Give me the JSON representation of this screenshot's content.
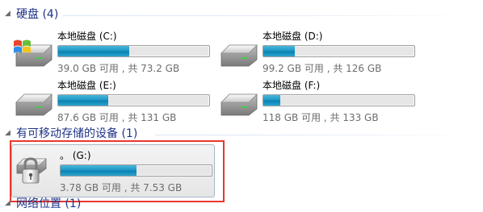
{
  "hard_disks": {
    "header": "硬盘 (4)",
    "drives": [
      {
        "name": "本地磁盘 (C:)",
        "free": "39.0 GB 可用 , 共 73.2 GB",
        "used_fraction": 0.47,
        "icon": "windows-system-drive-icon"
      },
      {
        "name": "本地磁盘 (D:)",
        "free": "99.2 GB 可用 , 共 126 GB",
        "used_fraction": 0.21,
        "icon": "hard-drive-icon"
      },
      {
        "name": "本地磁盘 (E:)",
        "free": "87.6 GB 可用 , 共 131 GB",
        "used_fraction": 0.33,
        "icon": "hard-drive-icon"
      },
      {
        "name": "本地磁盘 (F:)",
        "free": "118 GB 可用 , 共 133 GB",
        "used_fraction": 0.11,
        "icon": "hard-drive-icon"
      }
    ]
  },
  "removable": {
    "header": "有可移动存储的设备 (1)",
    "drives": [
      {
        "name": "。 (G:)",
        "free": "3.78 GB 可用 , 共 7.53 GB",
        "used_fraction": 0.5,
        "icon": "encrypted-drive-lock-icon"
      }
    ]
  },
  "network": {
    "header": "网络位置 (1)"
  },
  "colors": {
    "header_text": "#1e3287",
    "bar_fill": "#1b95c4",
    "highlight_outline": "#e8372f"
  }
}
